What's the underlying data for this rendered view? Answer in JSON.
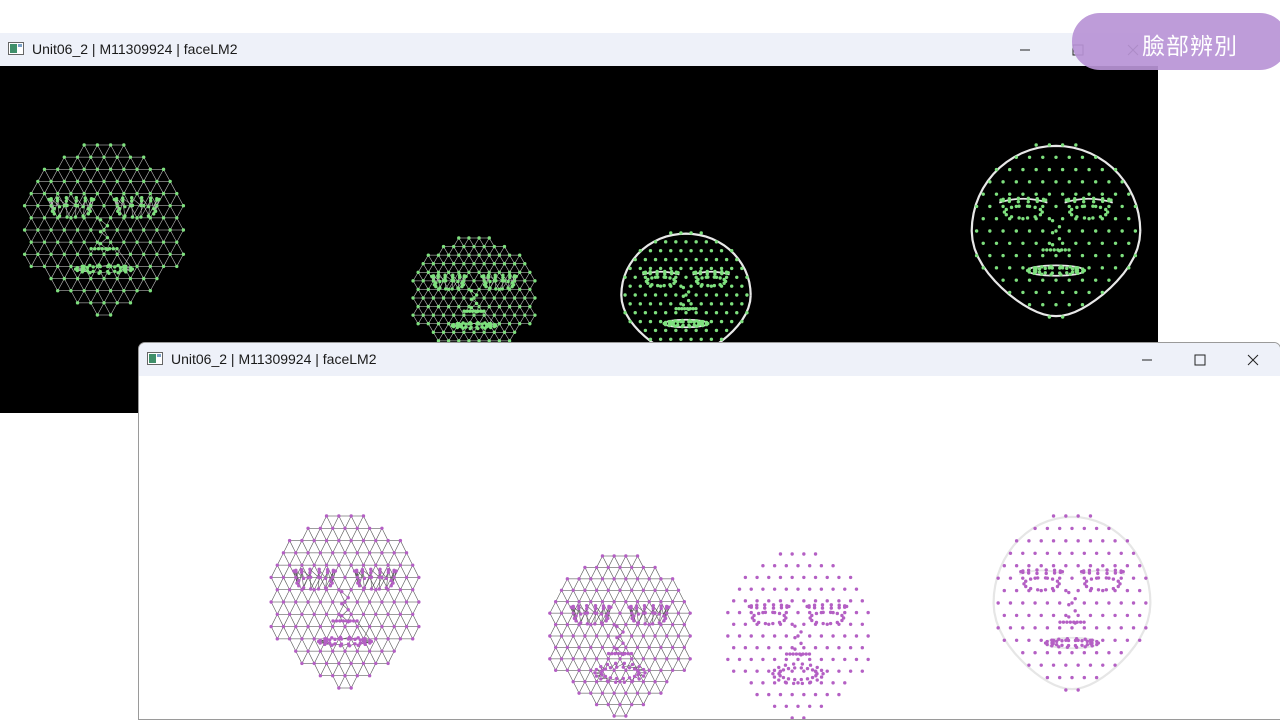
{
  "badge": {
    "label": "臉部辨別",
    "color": "#b994d6"
  },
  "windows": [
    {
      "title": "Unit06_2 | M11309924 | faceLM2",
      "app_icon": "opencv-window-icon",
      "controls": [
        "minimize-icon",
        "maximize-icon",
        "close-icon"
      ],
      "canvas_background": "#000000",
      "landmark_color": "#7ee07e",
      "mesh_color": "#bdbdbd",
      "faces": [
        {
          "view": "mesh-with-points"
        },
        {
          "view": "mesh-with-points"
        },
        {
          "view": "points-with-outline"
        },
        {
          "view": "points-with-outline"
        }
      ]
    },
    {
      "title": "Unit06_2 | M11309924 | faceLM2",
      "app_icon": "opencv-window-icon",
      "controls": [
        "minimize-icon",
        "maximize-icon",
        "close-icon"
      ],
      "canvas_background": "#ffffff",
      "landmark_color": "#b45fc4",
      "mesh_color": "#555555",
      "faces": [
        {
          "view": "mesh-with-points"
        },
        {
          "view": "mesh-with-points"
        },
        {
          "view": "points-only"
        },
        {
          "view": "points-with-faint-outline"
        }
      ]
    }
  ]
}
